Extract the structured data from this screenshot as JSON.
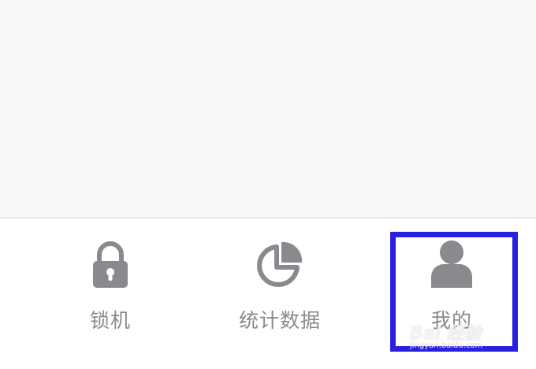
{
  "tab_bar": {
    "tabs": [
      {
        "label": "锁机",
        "icon": "lock-icon"
      },
      {
        "label": "统计数据",
        "icon": "pie-chart-icon"
      },
      {
        "label": "我的",
        "icon": "user-icon"
      }
    ]
  },
  "watermark": {
    "main": "Bai 经验",
    "sub": "jingyan.baidu.com"
  },
  "colors": {
    "icon": "#8a8a8e",
    "label": "#8a8a8e",
    "highlight": "#2b1fe0",
    "content_bg": "#f8f8f8"
  }
}
